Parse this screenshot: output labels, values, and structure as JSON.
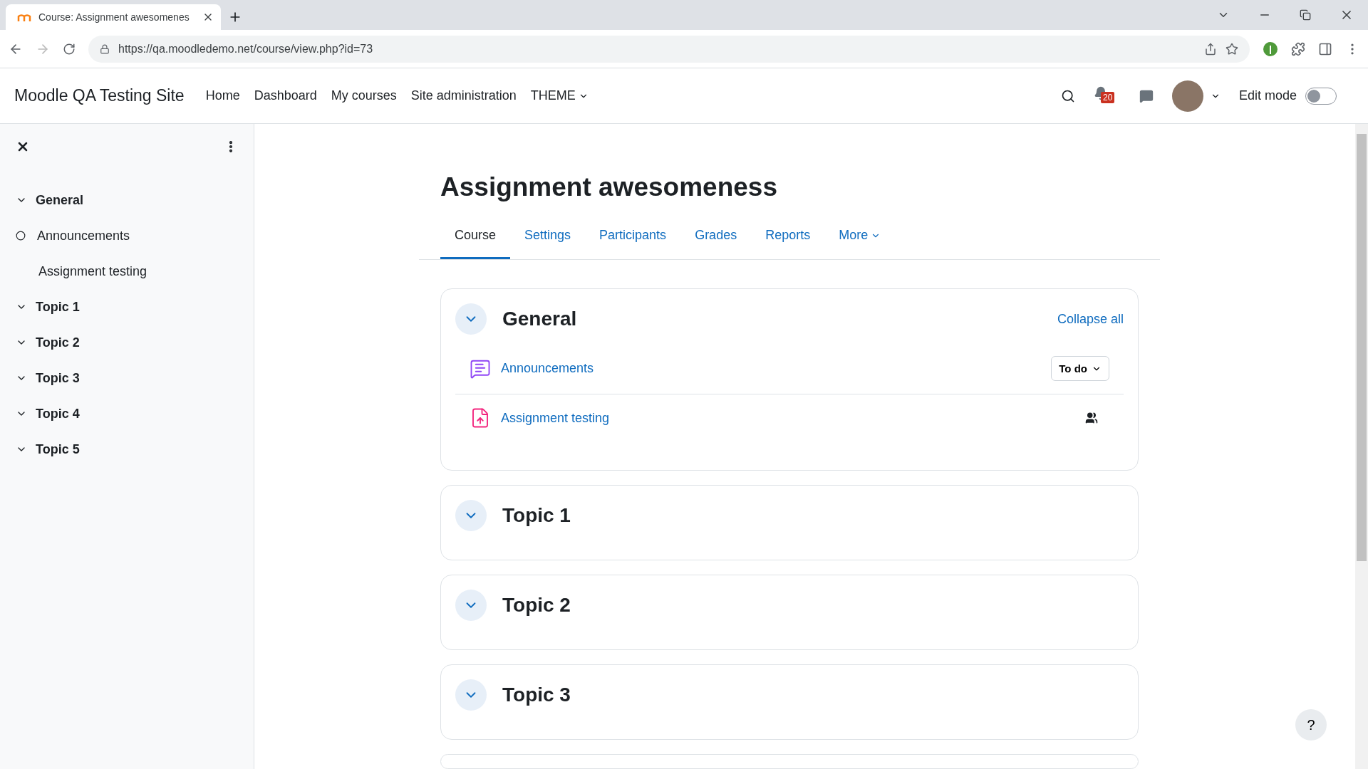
{
  "browser": {
    "tab_title": "Course: Assignment awesomenes",
    "url": "https://qa.moodledemo.net/course/view.php?id=73"
  },
  "navbar": {
    "site_name": "Moodle QA Testing Site",
    "links": [
      {
        "label": "Home",
        "dropdown": false
      },
      {
        "label": "Dashboard",
        "dropdown": false
      },
      {
        "label": "My courses",
        "dropdown": false
      },
      {
        "label": "Site administration",
        "dropdown": false
      },
      {
        "label": "THEME",
        "dropdown": true
      }
    ],
    "notification_count": "20",
    "edit_mode": {
      "label": "Edit mode",
      "on": false
    }
  },
  "sidebar": {
    "sections": [
      {
        "title": "General",
        "expanded": true,
        "children": [
          {
            "label": "Announcements",
            "completion": true
          },
          {
            "label": "Assignment testing",
            "completion": false
          }
        ]
      },
      {
        "title": "Topic 1",
        "expanded": true
      },
      {
        "title": "Topic 2",
        "expanded": true
      },
      {
        "title": "Topic 3",
        "expanded": true
      },
      {
        "title": "Topic 4",
        "expanded": true
      },
      {
        "title": "Topic 5",
        "expanded": true
      }
    ]
  },
  "course": {
    "title": "Assignment awesomeness",
    "tabs": [
      {
        "label": "Course",
        "selected": true,
        "dropdown": false
      },
      {
        "label": "Settings",
        "selected": false,
        "dropdown": false
      },
      {
        "label": "Participants",
        "selected": false,
        "dropdown": false
      },
      {
        "label": "Grades",
        "selected": false,
        "dropdown": false
      },
      {
        "label": "Reports",
        "selected": false,
        "dropdown": false
      },
      {
        "label": "More",
        "selected": false,
        "dropdown": true
      }
    ],
    "collapse_all": "Collapse all",
    "sections": [
      {
        "title": "General",
        "expanded": true,
        "activities": [
          {
            "kind": "forum",
            "name": "Announcements",
            "completion_button": "To do",
            "groups": false
          },
          {
            "kind": "assignment",
            "name": "Assignment testing",
            "groups": true
          }
        ]
      },
      {
        "title": "Topic 1",
        "expanded": true
      },
      {
        "title": "Topic 2",
        "expanded": true
      },
      {
        "title": "Topic 3",
        "expanded": true
      }
    ]
  },
  "help_button": "?"
}
